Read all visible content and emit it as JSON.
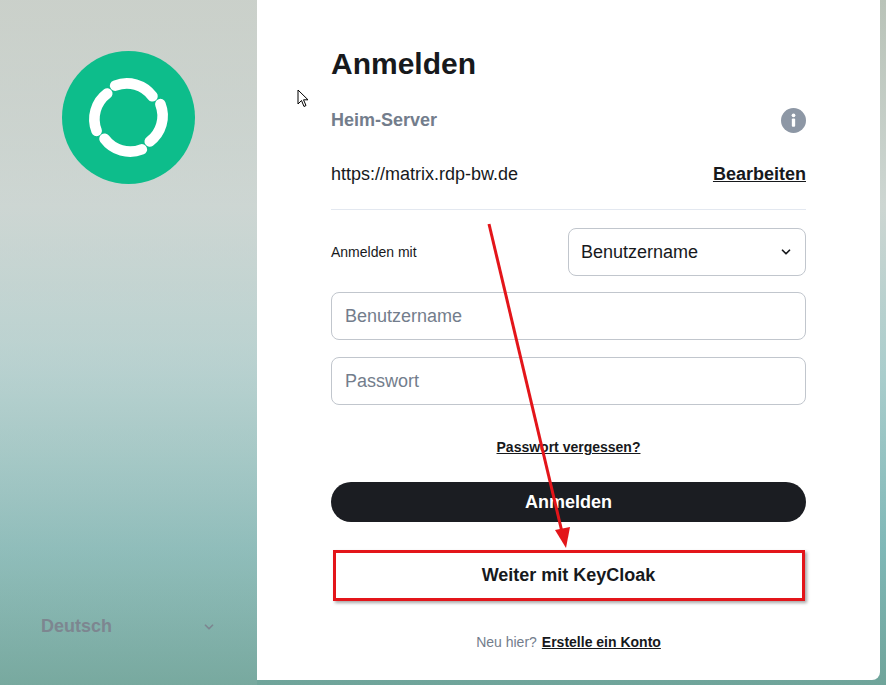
{
  "app": {
    "language": "Deutsch"
  },
  "login": {
    "title": "Anmelden",
    "homeserver_label": "Heim-Server",
    "homeserver_url": "https://matrix.rdp-bw.de",
    "edit_link": "Bearbeiten",
    "login_with_label": "Anmelden mit",
    "login_with_value": "Benutzername",
    "fields": [
      {
        "placeholder": "Benutzername",
        "kind": "text"
      },
      {
        "placeholder": "Passwort",
        "kind": "password"
      }
    ],
    "forgot_password": "Passwort vergessen?",
    "submit_button": "Anmelden",
    "sso_button": {
      "label": "Weiter mit KeyCloak",
      "highlighted": true
    },
    "register_prompt": "Neu hier?",
    "register_link": "Erstelle ein Konto"
  }
}
